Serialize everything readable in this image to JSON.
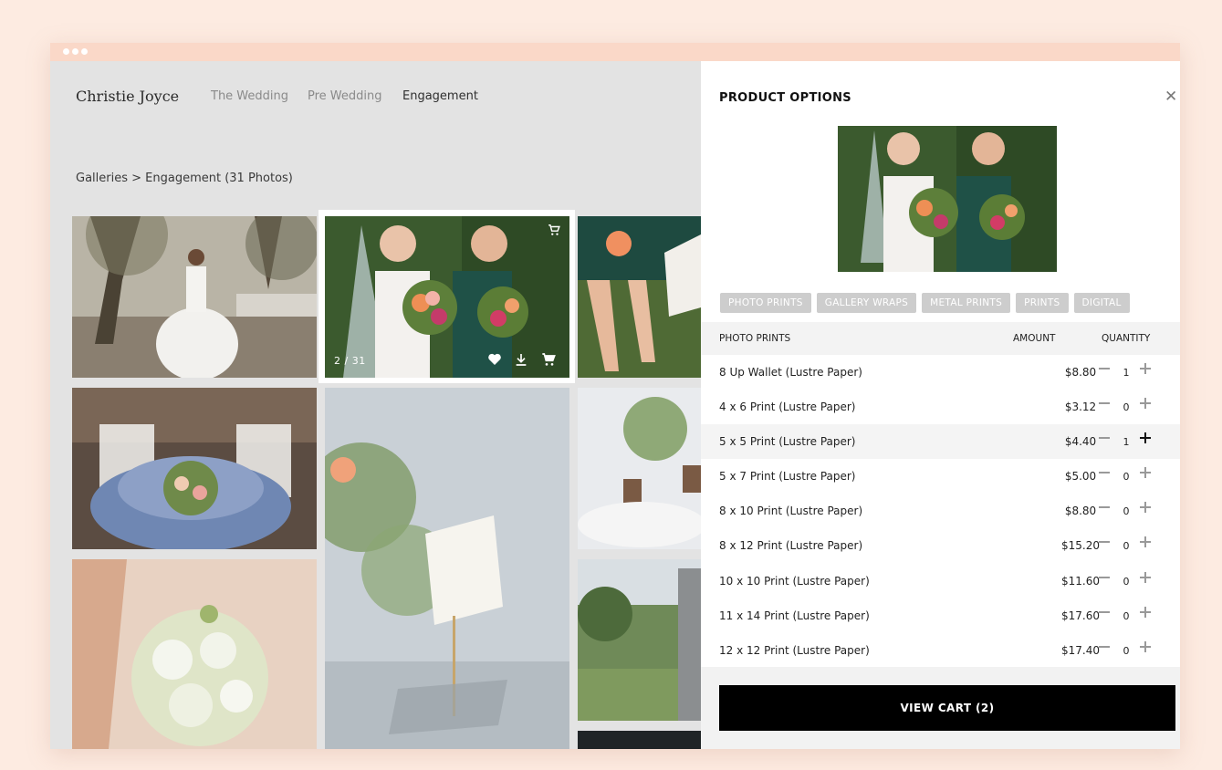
{
  "brand": "Christie Joyce",
  "nav": [
    {
      "label": "The Wedding",
      "active": false
    },
    {
      "label": "Pre Wedding",
      "active": false
    },
    {
      "label": "Engagement",
      "active": true
    }
  ],
  "breadcrumb": "Galleries > Engagement (31 Photos)",
  "selected_photo": {
    "counter": "2 / 31",
    "icons": [
      "cart-icon",
      "heart-icon",
      "download-icon",
      "cart-icon"
    ]
  },
  "panel": {
    "title": "PRODUCT OPTIONS",
    "close_icon": "close-icon",
    "tabs": [
      "PHOTO PRINTS",
      "GALLERY WRAPS",
      "METAL PRINTS",
      "PRINTS",
      "DIGITAL"
    ],
    "columns": {
      "name": "PHOTO PRINTS",
      "amount": "AMOUNT",
      "quantity": "QUANTITY"
    },
    "rows": [
      {
        "name": "8 Up Wallet (Lustre Paper)",
        "amount": "$8.80",
        "qty": "1"
      },
      {
        "name": "4 x 6 Print (Lustre Paper)",
        "amount": "$3.12",
        "qty": "0"
      },
      {
        "name": "5 x 5 Print (Lustre Paper)",
        "amount": "$4.40",
        "qty": "1"
      },
      {
        "name": "5 x 7 Print (Lustre Paper)",
        "amount": "$5.00",
        "qty": "0"
      },
      {
        "name": "8 x 10 Print (Lustre Paper)",
        "amount": "$8.80",
        "qty": "0"
      },
      {
        "name": "8 x 12 Print (Lustre Paper)",
        "amount": "$15.20",
        "qty": "0"
      },
      {
        "name": "10 x 10 Print (Lustre Paper)",
        "amount": "$11.60",
        "qty": "0"
      },
      {
        "name": "11 x 14 Print (Lustre Paper)",
        "amount": "$17.60",
        "qty": "0"
      },
      {
        "name": "12 x 12 Print (Lustre Paper)",
        "amount": "$17.40",
        "qty": "0"
      }
    ],
    "cart_button": "VIEW CART (2)"
  },
  "colors": {
    "page_bg": "#fdebe1",
    "gallery_bg": "#e3e3e3",
    "chip": "#cdcdcd",
    "button": "#000000"
  }
}
